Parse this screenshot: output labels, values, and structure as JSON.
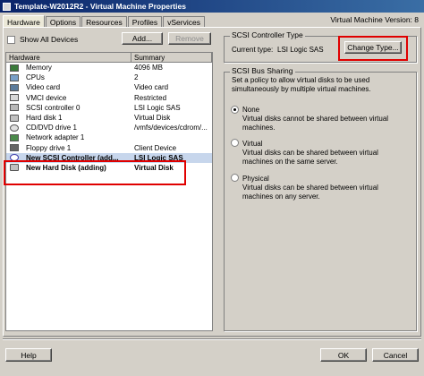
{
  "window": {
    "title": "Template-W2012R2 - Virtual Machine Properties",
    "version_label": "Virtual Machine Version: 8"
  },
  "tabs": [
    {
      "label": "Hardware",
      "active": true
    },
    {
      "label": "Options"
    },
    {
      "label": "Resources"
    },
    {
      "label": "Profiles"
    },
    {
      "label": "vServices"
    }
  ],
  "left": {
    "show_all_label": "Show All Devices",
    "add_label": "Add...",
    "remove_label": "Remove",
    "columns": {
      "hardware": "Hardware",
      "summary": "Summary"
    },
    "rows": [
      {
        "name": "Memory",
        "summary": "4096 MB",
        "icon": "memory-icon"
      },
      {
        "name": "CPUs",
        "summary": "2",
        "icon": "cpu-icon"
      },
      {
        "name": "Video card",
        "summary": "Video card",
        "icon": "video-card-icon"
      },
      {
        "name": "VMCI device",
        "summary": "Restricted",
        "icon": "vmci-icon"
      },
      {
        "name": "SCSI controller 0",
        "summary": "LSI Logic SAS",
        "icon": "scsi-controller-icon"
      },
      {
        "name": "Hard disk 1",
        "summary": "Virtual Disk",
        "icon": "hard-disk-icon"
      },
      {
        "name": "CD/DVD drive 1",
        "summary": "/vmfs/devices/cdrom/...",
        "icon": "cd-dvd-icon"
      },
      {
        "name": "Network adapter 1",
        "summary": "",
        "icon": "network-adapter-icon"
      },
      {
        "name": "Floppy drive 1",
        "summary": "Client Device",
        "icon": "floppy-icon"
      },
      {
        "name": "New SCSI Controller (add...",
        "summary": "LSI Logic SAS",
        "icon": "new-scsi-controller-icon"
      },
      {
        "name": "New Hard Disk (adding)",
        "summary": "Virtual Disk",
        "icon": "new-hard-disk-icon"
      }
    ]
  },
  "right": {
    "controller_type": {
      "group_label": "SCSI Controller Type",
      "current_label": "Current type:",
      "current_value": "LSI Logic SAS",
      "change_button": "Change Type..."
    },
    "bus_sharing": {
      "group_label": "SCSI Bus Sharing",
      "description": "Set a policy to allow virtual disks to be used simultaneously by multiple virtual machines.",
      "options": [
        {
          "label": "None",
          "desc": "Virtual disks cannot be shared between virtual machines.",
          "selected": true
        },
        {
          "label": "Virtual",
          "desc": "Virtual disks can be shared between virtual machines on the same server.",
          "selected": false
        },
        {
          "label": "Physical",
          "desc": "Virtual disks can be shared between virtual machines on any server.",
          "selected": false
        }
      ]
    }
  },
  "footer": {
    "help_label": "Help",
    "ok_label": "OK",
    "cancel_label": "Cancel"
  },
  "colors": {
    "highlight_box": "#e00000",
    "selected_row": "#c7d6ec",
    "title_bar": "#0a246a"
  }
}
